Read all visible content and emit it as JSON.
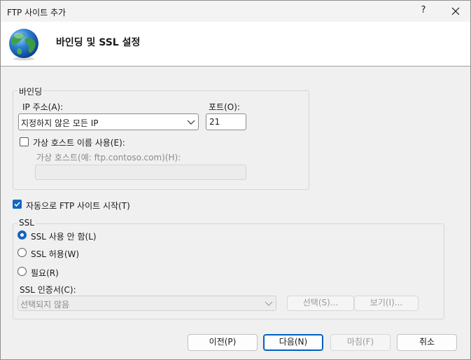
{
  "window": {
    "title": "FTP 사이트 추가",
    "help_label": "?",
    "header_title": "바인딩 및 SSL 설정"
  },
  "binding": {
    "group_label": "바인딩",
    "ip_label": "IP 주소(A):",
    "ip_value": "지정하지 않은 모든 IP",
    "port_label": "포트(O):",
    "port_value": "21",
    "virtual_host_checkbox_label": "가상 호스트 이름 사용(E):",
    "virtual_host_checked": false,
    "virtual_host_label": "가상 호스트(예: ftp.contoso.com)(H):",
    "virtual_host_value": ""
  },
  "autostart": {
    "label": "자동으로 FTP 사이트 시작(T)",
    "checked": true
  },
  "ssl": {
    "group_label": "SSL",
    "options": [
      {
        "label": "SSL 사용 안 함(L)",
        "selected": true
      },
      {
        "label": "SSL 허용(W)",
        "selected": false
      },
      {
        "label": "필요(R)",
        "selected": false
      }
    ],
    "cert_label": "SSL 인증서(C):",
    "cert_value": "선택되지 않음",
    "select_button": "선택(S)...",
    "view_button": "보기(I)..."
  },
  "footer": {
    "previous": "이전(P)",
    "next": "다음(N)",
    "finish": "마침(F)",
    "cancel": "취소"
  },
  "colors": {
    "accent": "#1565c0",
    "disabled_text": "#8a8a8a"
  }
}
